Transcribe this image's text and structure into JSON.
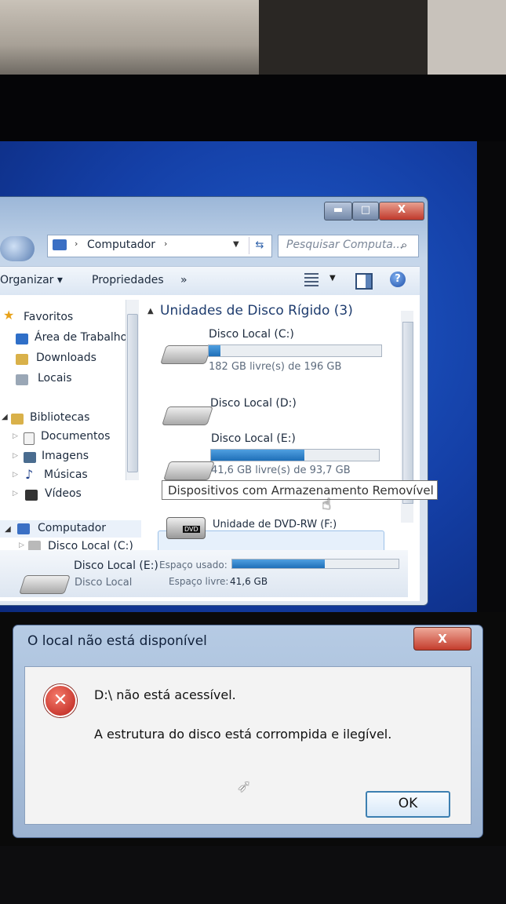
{
  "explorer": {
    "caption": {
      "minimize_glyph": "▬",
      "maximize_glyph": "□",
      "close_glyph": "X"
    },
    "address": {
      "location": "Computador",
      "arrow": "›"
    },
    "search": {
      "placeholder": "Pesquisar Computa..."
    },
    "toolbar": {
      "organize": "Organizar ▾",
      "properties": "Propriedades",
      "more": "»"
    },
    "nav": {
      "favorites": "Favoritos",
      "desktop": "Área de Trabalho",
      "downloads": "Downloads",
      "places": "Locais",
      "libraries": "Bibliotecas",
      "documents": "Documentos",
      "images": "Imagens",
      "music": "Músicas",
      "videos": "Vídeos",
      "computer": "Computador",
      "disk_c": "Disco Local (C:)"
    },
    "sections": {
      "hard_disks": "Unidades de Disco Rígido (3)",
      "removable": "Dispositivos com Armazenamento Removível"
    },
    "drives": [
      {
        "name": "Disco Local (C:)",
        "free_text": "182 GB livre(s) de 196 GB",
        "used_fraction": 0.07
      },
      {
        "name": "Disco Local (D:)"
      },
      {
        "name": "Disco Local (E:)",
        "free_text": "41,6 GB livre(s) de 93,7 GB",
        "used_fraction": 0.556
      }
    ],
    "dvd": {
      "name": "Unidade de DVD-RW (F:)",
      "badge": "DVD"
    },
    "details": {
      "name": "Disco Local (E:)",
      "type": "Disco Local",
      "used_label": "Espaço usado:",
      "free_label": "Espaço livre:",
      "free_value": "41,6 GB",
      "used_fraction": 0.556
    }
  },
  "dialog": {
    "title": "O local não está disponível",
    "close_label": "X",
    "message_title": "D:\\ não está acessível.",
    "message_body": "A estrutura do disco está corrompida e ilegível.",
    "ok_label": "OK",
    "icon": "error-icon"
  },
  "colors": {
    "accent": "#1f6fb8",
    "error": "#c43c2c",
    "desktop": "#143fa6"
  }
}
